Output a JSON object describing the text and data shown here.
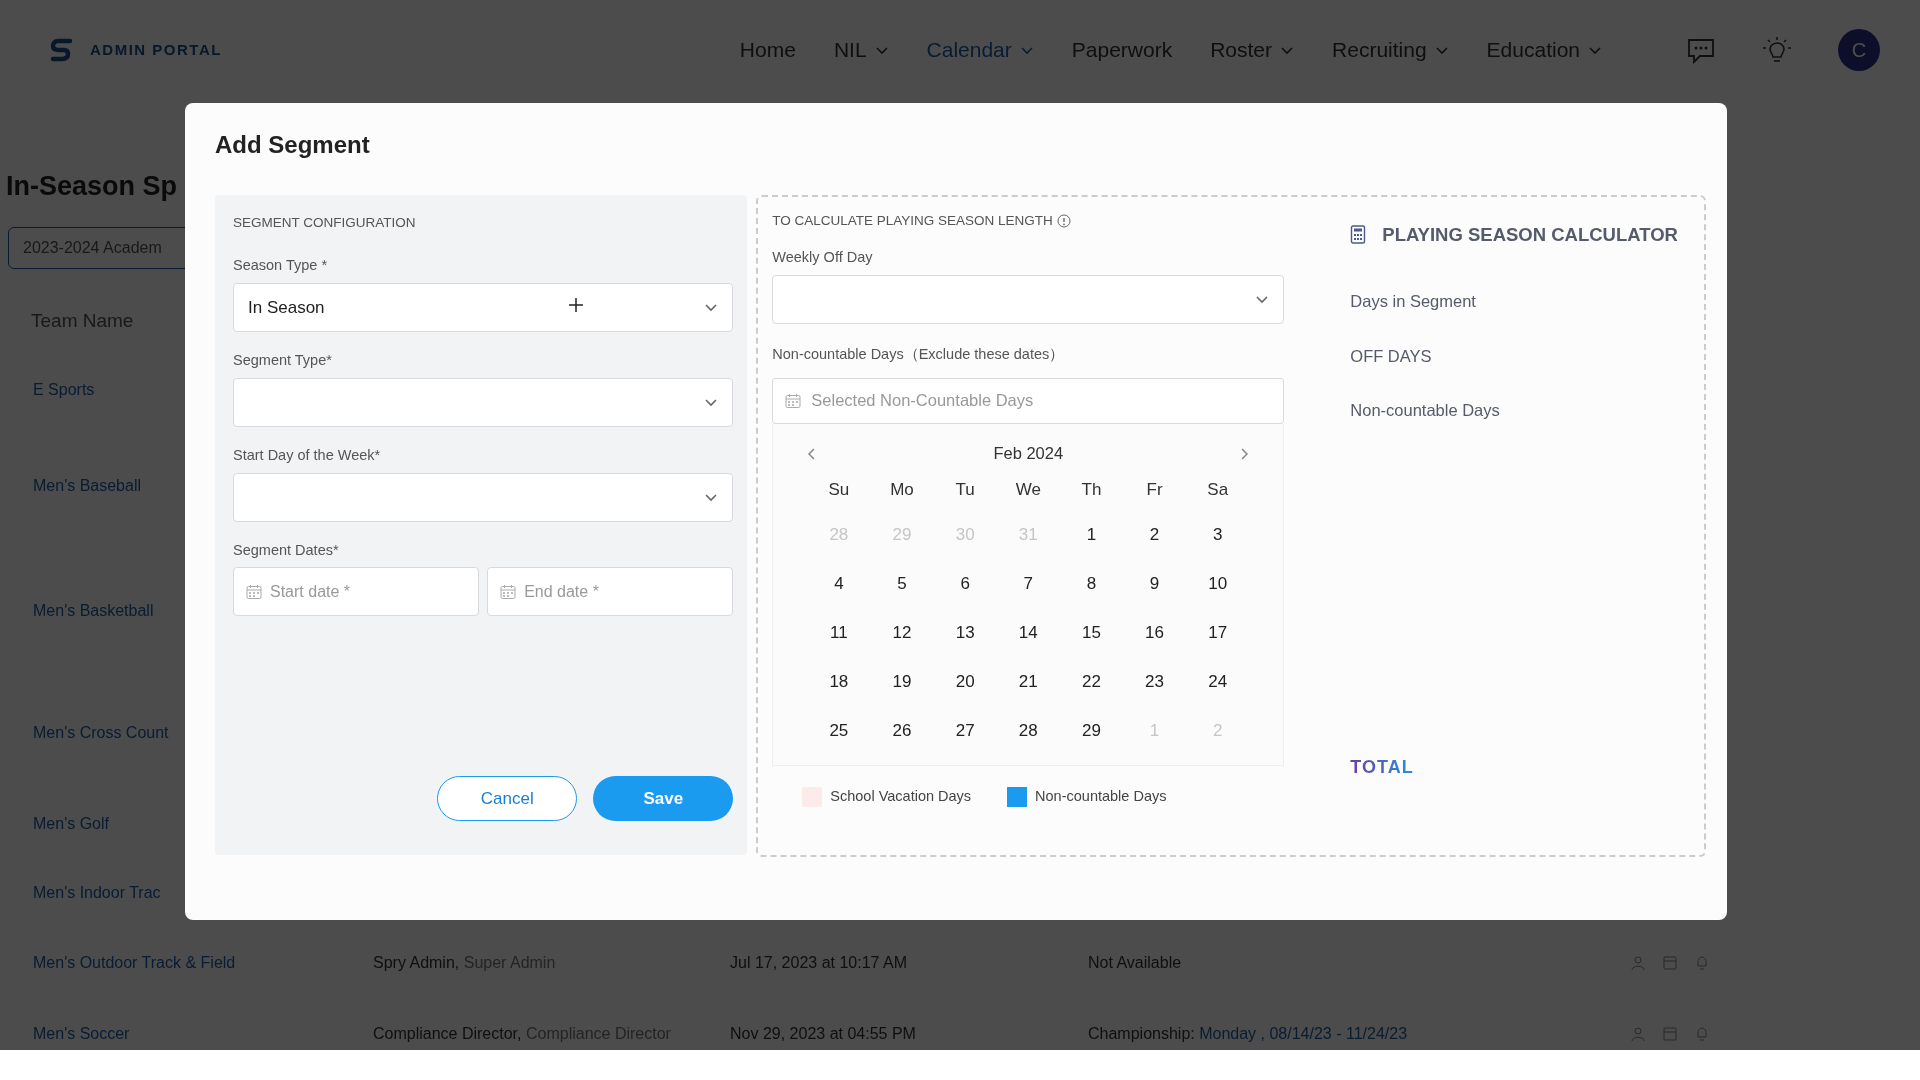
{
  "navbar": {
    "brand": "ADMIN PORTAL",
    "items": [
      {
        "label": "Home",
        "dropdown": false,
        "selected": false
      },
      {
        "label": "NIL",
        "dropdown": true,
        "selected": false
      },
      {
        "label": "Calendar",
        "dropdown": true,
        "selected": true
      },
      {
        "label": "Paperwork",
        "dropdown": false,
        "selected": false
      },
      {
        "label": "Roster",
        "dropdown": true,
        "selected": false
      },
      {
        "label": "Recruiting",
        "dropdown": true,
        "selected": false
      },
      {
        "label": "Education",
        "dropdown": true,
        "selected": false
      }
    ],
    "avatar": "C"
  },
  "page": {
    "title": "In-Season Sp",
    "year_select": "2023-2024 Academ",
    "table": {
      "columns": [
        "Team Name"
      ],
      "rows": [
        {
          "team": "E Sports"
        },
        {
          "team": "Men's Baseball"
        },
        {
          "team": "Men's Basketball"
        },
        {
          "team": "Men's Cross Count"
        },
        {
          "team": "Men's Golf"
        },
        {
          "team": "Men's Indoor Trac"
        },
        {
          "team": "Men's Outdoor Track & Field",
          "created_by": [
            {
              "text": "Spry Admin,",
              "kind": "plain"
            },
            {
              "text": "Super Admin",
              "kind": "muted"
            }
          ],
          "date": "Jul 17, 2023 at 10:17 AM",
          "status": [
            {
              "text": "Not Available",
              "kind": "plain"
            }
          ]
        },
        {
          "team": "Men's Soccer",
          "created_by": [
            {
              "text": "Compliance Director,",
              "kind": "plain"
            },
            {
              "text": "Compliance Director",
              "kind": "muted"
            }
          ],
          "date": "Nov 29, 2023 at 04:55 PM",
          "status": [
            {
              "text": "Championship:",
              "kind": "plain"
            },
            {
              "text": "Monday , 08/14/23 - 11/24/23",
              "kind": "link"
            }
          ]
        }
      ]
    }
  },
  "modal": {
    "title": "Add Segment",
    "config": {
      "heading": "SEGMENT CONFIGURATION",
      "fields": [
        {
          "kind": "select",
          "label": "Season Type *",
          "value": "In Season"
        },
        {
          "kind": "select",
          "label": "Segment Type*"
        },
        {
          "kind": "select",
          "label": "Start Day of the Week*"
        },
        {
          "kind": "dates",
          "label": "Segment Dates*",
          "placeholders": [
            "Start date *",
            "End date *"
          ]
        }
      ],
      "buttons": [
        {
          "label": "Cancel",
          "kind": "outline"
        },
        {
          "label": "Save",
          "kind": "primary"
        }
      ]
    },
    "length": {
      "heading": "TO CALCULATE PLAYING SEASON LENGTH",
      "weekly_off_label": "Weekly Off Day",
      "noncountable_label": "Non-countable Days（Exclude these dates）",
      "noncountable_placeholder": "Selected Non-Countable Days",
      "calendar": {
        "month": "Feb 2024",
        "weekdays": [
          "Su",
          "Mo",
          "Tu",
          "We",
          "Th",
          "Fr",
          "Sa"
        ],
        "weeks": [
          [
            {
              "day": "28",
              "muted": true
            },
            {
              "day": "29",
              "muted": true
            },
            {
              "day": "30",
              "muted": true
            },
            {
              "day": "31",
              "muted": true
            },
            {
              "day": "1",
              "muted": false
            },
            {
              "day": "2",
              "muted": false
            },
            {
              "day": "3",
              "muted": false
            }
          ],
          [
            {
              "day": "4",
              "muted": false
            },
            {
              "day": "5",
              "muted": false
            },
            {
              "day": "6",
              "muted": false
            },
            {
              "day": "7",
              "muted": false
            },
            {
              "day": "8",
              "muted": false
            },
            {
              "day": "9",
              "muted": false
            },
            {
              "day": "10",
              "muted": false
            }
          ],
          [
            {
              "day": "11",
              "muted": false
            },
            {
              "day": "12",
              "muted": false
            },
            {
              "day": "13",
              "muted": false
            },
            {
              "day": "14",
              "muted": false
            },
            {
              "day": "15",
              "muted": false
            },
            {
              "day": "16",
              "muted": false
            },
            {
              "day": "17",
              "muted": false
            }
          ],
          [
            {
              "day": "18",
              "muted": false
            },
            {
              "day": "19",
              "muted": false
            },
            {
              "day": "20",
              "muted": false
            },
            {
              "day": "21",
              "muted": false
            },
            {
              "day": "22",
              "muted": false
            },
            {
              "day": "23",
              "muted": false
            },
            {
              "day": "24",
              "muted": false
            }
          ],
          [
            {
              "day": "25",
              "muted": false
            },
            {
              "day": "26",
              "muted": false
            },
            {
              "day": "27",
              "muted": false
            },
            {
              "day": "28",
              "muted": false
            },
            {
              "day": "29",
              "muted": false
            },
            {
              "day": "1",
              "muted": true
            },
            {
              "day": "2",
              "muted": true
            }
          ]
        ]
      },
      "legend": [
        {
          "label": "School Vacation Days",
          "color": "#fdeaea"
        },
        {
          "label": "Non-countable Days",
          "color": "#1a9bf0"
        }
      ]
    },
    "calculator": {
      "title": "PLAYING SEASON CALCULATOR",
      "rows": [
        "Days in Segment",
        "OFF DAYS",
        "Non-countable Days"
      ],
      "total": "TOTAL"
    }
  }
}
